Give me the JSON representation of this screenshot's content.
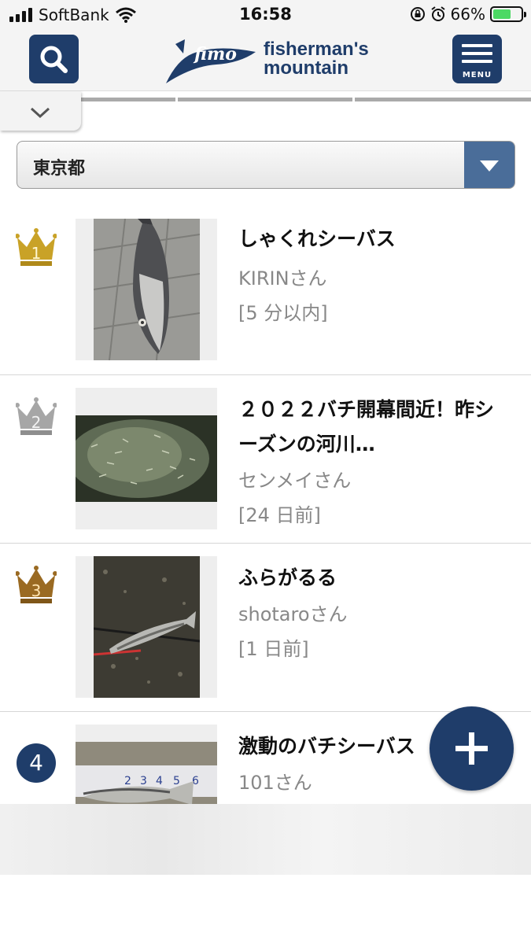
{
  "status_bar": {
    "carrier": "SoftBank",
    "time": "16:58",
    "battery_percent": "66%",
    "battery_level": 0.66
  },
  "header": {
    "logo_line1": "fisherman's",
    "logo_line2": "mountain",
    "logo_mark": "fimo",
    "menu_label": "MENU"
  },
  "filter": {
    "prefecture": "東京都"
  },
  "ranking": [
    {
      "rank": "1",
      "badge": "gold-crown",
      "title_line1": "しゃくれシーバス",
      "title_line2": "",
      "user": "KIRINさん",
      "time": "[5 分以内]"
    },
    {
      "rank": "2",
      "badge": "silver-crown",
      "title_line1": "２０２２バチ開幕間近！昨シ",
      "title_line2": "ーズンの河川…",
      "user": "センメイさん",
      "time": "[24 日前]"
    },
    {
      "rank": "3",
      "badge": "bronze-crown",
      "title_line1": "ふらがるる",
      "title_line2": "",
      "user": "shotaroさん",
      "time": "[1 日前]"
    },
    {
      "rank": "4",
      "badge": "number-circle",
      "title_line1": "激動のバチシーバス",
      "title_line2": "",
      "user": "101さん",
      "time": ""
    }
  ],
  "colors": {
    "brand_navy": "#1f3d6a",
    "select_arrow": "#4a6d99",
    "gold": "#c9a227",
    "silver": "#a6a6a6",
    "bronze": "#9a6a22"
  },
  "icons": {
    "search": "search-icon",
    "menu": "hamburger-icon",
    "collapse": "chevron-down-icon",
    "dropdown": "triangle-down-icon",
    "add": "plus-icon"
  }
}
